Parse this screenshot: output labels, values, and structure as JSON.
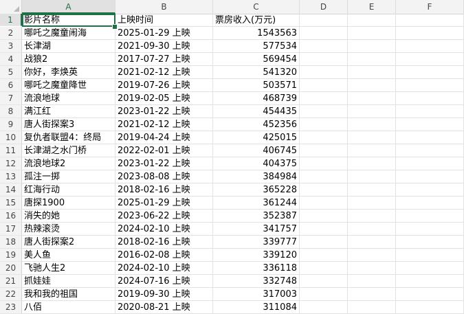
{
  "columns": [
    "A",
    "B",
    "C",
    "D",
    "E",
    "F"
  ],
  "header_row": {
    "a": "影片名称",
    "b": "上映时间",
    "c": "票房收入(万元)"
  },
  "rows": [
    {
      "num": "2",
      "name": "哪吒之魔童闹海",
      "date": "2025-01-29 上映",
      "box": "1543563"
    },
    {
      "num": "3",
      "name": "长津湖",
      "date": "2021-09-30 上映",
      "box": "577534"
    },
    {
      "num": "4",
      "name": "战狼2",
      "date": "2017-07-27 上映",
      "box": "569454"
    },
    {
      "num": "5",
      "name": "你好，李焕英",
      "date": "2021-02-12 上映",
      "box": "541320"
    },
    {
      "num": "6",
      "name": "哪吒之魔童降世",
      "date": "2019-07-26 上映",
      "box": "503571"
    },
    {
      "num": "7",
      "name": "流浪地球",
      "date": "2019-02-05 上映",
      "box": "468739"
    },
    {
      "num": "8",
      "name": "满江红",
      "date": "2023-01-22 上映",
      "box": "454435"
    },
    {
      "num": "9",
      "name": "唐人街探案3",
      "date": "2021-02-12 上映",
      "box": "452356"
    },
    {
      "num": "10",
      "name": "复仇者联盟4：终局",
      "date": "2019-04-24 上映",
      "box": "425015"
    },
    {
      "num": "11",
      "name": "长津湖之水门桥",
      "date": "2022-02-01 上映",
      "box": "406745"
    },
    {
      "num": "12",
      "name": "流浪地球2",
      "date": "2023-01-22 上映",
      "box": "404375"
    },
    {
      "num": "13",
      "name": "孤注一掷",
      "date": "2023-08-08 上映",
      "box": "384984"
    },
    {
      "num": "14",
      "name": "红海行动",
      "date": "2018-02-16 上映",
      "box": "365228"
    },
    {
      "num": "15",
      "name": "唐探1900",
      "date": "2025-01-29 上映",
      "box": "361244"
    },
    {
      "num": "16",
      "name": "消失的她",
      "date": "2023-06-22 上映",
      "box": "352387"
    },
    {
      "num": "17",
      "name": "热辣滚烫",
      "date": "2024-02-10 上映",
      "box": "341757"
    },
    {
      "num": "18",
      "name": "唐人街探案2",
      "date": "2018-02-16 上映",
      "box": "339777"
    },
    {
      "num": "19",
      "name": "美人鱼",
      "date": "2016-02-08 上映",
      "box": "339120"
    },
    {
      "num": "20",
      "name": "飞驰人生2",
      "date": "2024-02-10 上映",
      "box": "336118"
    },
    {
      "num": "21",
      "name": "抓娃娃",
      "date": "2024-07-16 上映",
      "box": "332748"
    },
    {
      "num": "22",
      "name": "我和我的祖国",
      "date": "2019-09-30 上映",
      "box": "317003"
    },
    {
      "num": "23",
      "name": "八佰",
      "date": "2020-08-21 上映",
      "box": "311084"
    }
  ],
  "first_row_num": "1",
  "selected_cell": "A1",
  "colors": {
    "accent": "#1e7145",
    "header_bg": "#f3f3f3"
  }
}
